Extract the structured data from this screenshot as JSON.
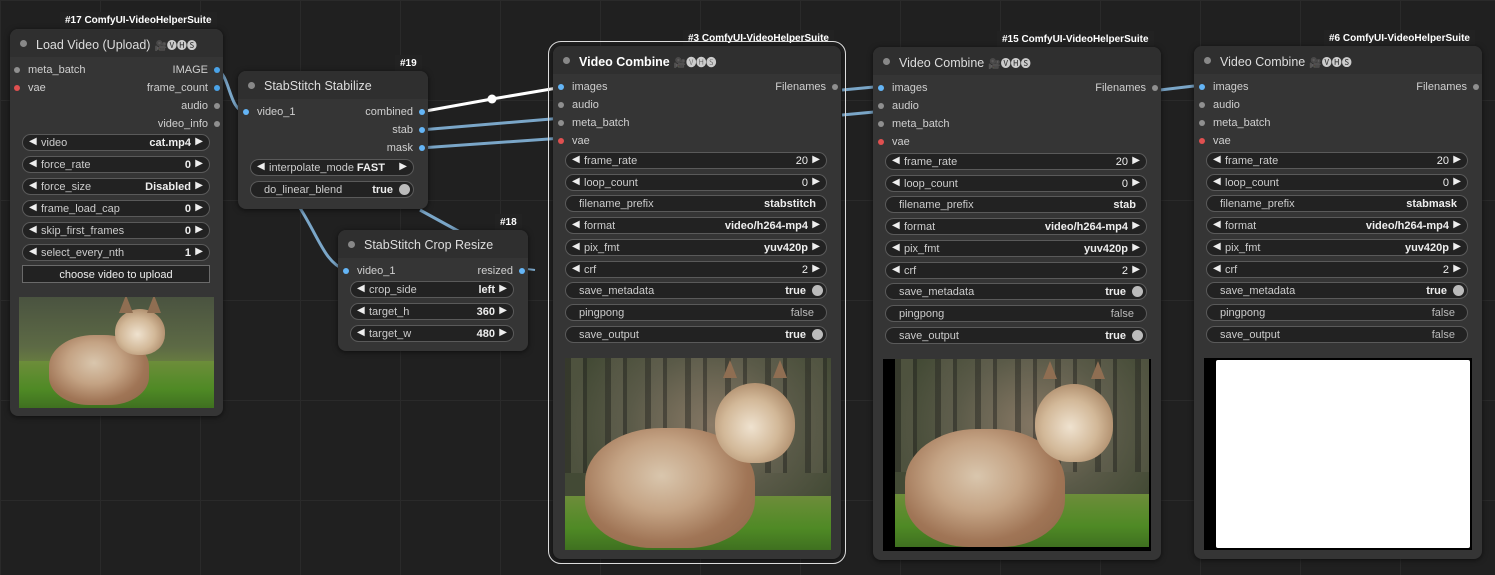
{
  "nodes": {
    "load_video": {
      "badge": "#17 ComfyUI-VideoHelperSuite",
      "title": "Load Video (Upload)",
      "suffix": "🎥🅥🅗🅢",
      "inputs": [
        "meta_batch",
        "vae"
      ],
      "outputs": [
        "IMAGE",
        "frame_count",
        "audio",
        "video_info"
      ],
      "widgets": [
        {
          "label": "video",
          "value": "cat.mp4"
        },
        {
          "label": "force_rate",
          "value": "0"
        },
        {
          "label": "force_size",
          "value": "Disabled"
        },
        {
          "label": "frame_load_cap",
          "value": "0"
        },
        {
          "label": "skip_first_frames",
          "value": "0"
        },
        {
          "label": "select_every_nth",
          "value": "1"
        }
      ],
      "upload_button": "choose video to upload"
    },
    "stabilize": {
      "badge": "#19",
      "title": "StabStitch Stabilize",
      "inputs": [
        "video_1"
      ],
      "outputs": [
        "combined",
        "stab",
        "mask"
      ],
      "interpolate_label": "interpolate_mode",
      "interpolate_value": "FAST",
      "blend_label": "do_linear_blend",
      "blend_value": "true"
    },
    "crop_resize": {
      "badge": "#18",
      "title": "StabStitch Crop Resize",
      "inputs": [
        "video_1"
      ],
      "outputs": [
        "resized"
      ],
      "widgets": [
        {
          "label": "crop_side",
          "value": "left"
        },
        {
          "label": "target_h",
          "value": "360"
        },
        {
          "label": "target_w",
          "value": "480"
        }
      ]
    },
    "combine3": {
      "badge": "#3 ComfyUI-VideoHelperSuite",
      "title": "Video Combine",
      "suffix": "🎥🅥🅗🅢",
      "inputs": [
        "images",
        "audio",
        "meta_batch",
        "vae"
      ],
      "output": "Filenames",
      "frame_rate": "20",
      "loop_count": "0",
      "filename_prefix": "stabstitch",
      "format": "video/h264-mp4",
      "pix_fmt": "yuv420p",
      "crf": "2",
      "save_metadata": "true",
      "pingpong": "false",
      "save_output": "true"
    },
    "combine15": {
      "badge": "#15 ComfyUI-VideoHelperSuite",
      "title": "Video Combine",
      "suffix": "🎥🅥🅗🅢",
      "inputs": [
        "images",
        "audio",
        "meta_batch",
        "vae"
      ],
      "output": "Filenames",
      "frame_rate": "20",
      "loop_count": "0",
      "filename_prefix": "stab",
      "format": "video/h264-mp4",
      "pix_fmt": "yuv420p",
      "crf": "2",
      "save_metadata": "true",
      "pingpong": "false",
      "save_output": "true"
    },
    "combine6": {
      "badge": "#6 ComfyUI-VideoHelperSuite",
      "title": "Video Combine",
      "suffix": "🎥🅥🅗🅢",
      "inputs": [
        "images",
        "audio",
        "meta_batch",
        "vae"
      ],
      "output": "Filenames",
      "frame_rate": "20",
      "loop_count": "0",
      "filename_prefix": "stabmask",
      "format": "video/h264-mp4",
      "pix_fmt": "yuv420p",
      "crf": "2",
      "save_metadata": "true",
      "pingpong": "false",
      "save_output": "false"
    }
  },
  "labels": {
    "frame_rate": "frame_rate",
    "loop_count": "loop_count",
    "filename_prefix": "filename_prefix",
    "format": "format",
    "pix_fmt": "pix_fmt",
    "crf": "crf",
    "save_metadata": "save_metadata",
    "pingpong": "pingpong",
    "save_output": "save_output"
  },
  "colors": {
    "canvas": "#202020",
    "node": "#353535",
    "link_image": "#7aa6c8",
    "link_selected": "#ffffff"
  }
}
